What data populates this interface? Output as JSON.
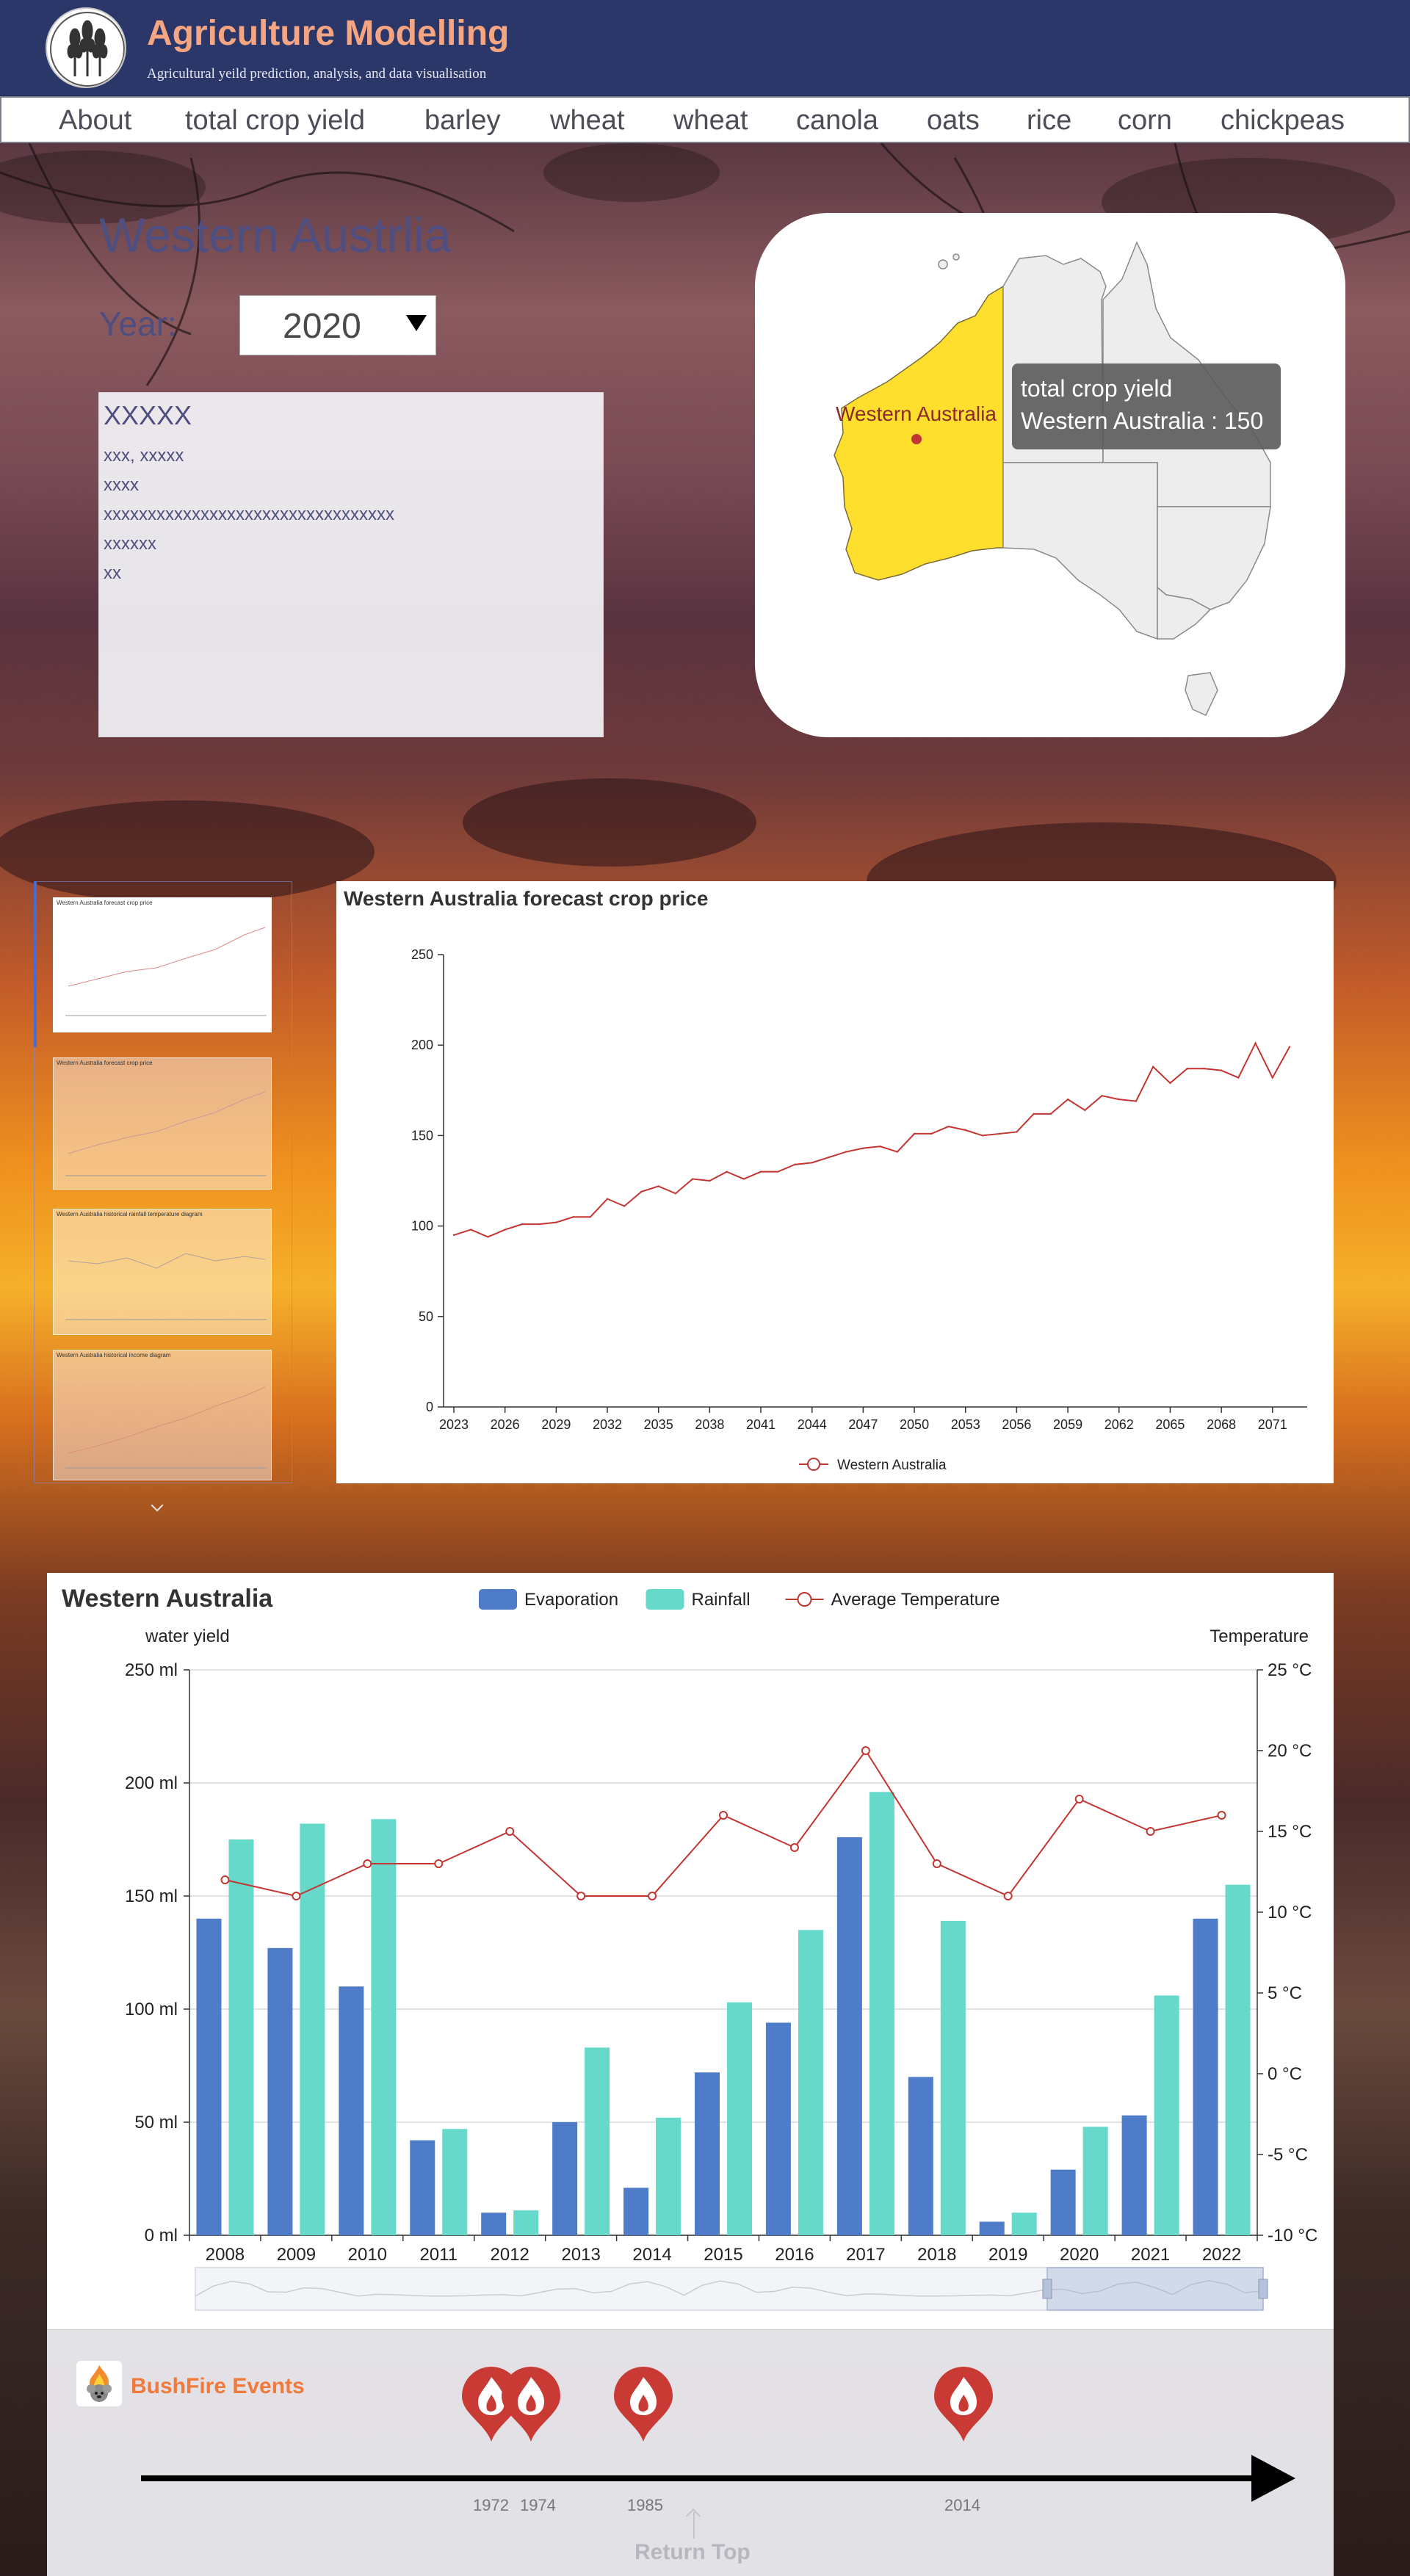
{
  "header": {
    "title": "Agriculture Modelling",
    "subtitle": "Agricultural yeild prediction, analysis, and data visualisation"
  },
  "nav": {
    "items": [
      "About",
      "total crop yield",
      "barley",
      "wheat",
      "wheat",
      "canola",
      "oats",
      "rice",
      "corn",
      "chickpeas"
    ]
  },
  "region": {
    "title": "Western Austrlia",
    "year_label": "Year:",
    "year_value": "2020"
  },
  "info": {
    "lines": [
      "XXXXX",
      "xxx, xxxxx",
      "xxxx",
      "xxxxxxxxxxxxxxxxxxxxxxxxxxxxxxxxx",
      "xxxxxx",
      "xx"
    ]
  },
  "map": {
    "region_label": "Western Australia",
    "tooltip_title": "total crop yield",
    "tooltip_value": "Western Australia : 150",
    "highlight_color": "#ffdf2e"
  },
  "thumbnails": {
    "titles": [
      "Western Australia forecast crop price",
      "Western Australia forecast crop price",
      "Western Australia historical rainfall temperature diagram",
      "Western Australia historical income diagram"
    ]
  },
  "chart_data": [
    {
      "type": "line",
      "title": "Western Australia forecast crop price",
      "x": [
        2023,
        2024,
        2025,
        2026,
        2027,
        2028,
        2029,
        2030,
        2031,
        2032,
        2033,
        2034,
        2035,
        2036,
        2037,
        2038,
        2039,
        2040,
        2041,
        2042,
        2043,
        2044,
        2045,
        2046,
        2047,
        2048,
        2049,
        2050,
        2051,
        2052,
        2053,
        2054,
        2055,
        2056,
        2057,
        2058,
        2059,
        2060,
        2061,
        2062,
        2063,
        2064,
        2065,
        2066,
        2067,
        2068,
        2069,
        2070,
        2071,
        2072
      ],
      "x_ticks": [
        "2023",
        "2026",
        "2029",
        "2032",
        "2035",
        "2038",
        "2041",
        "2044",
        "2047",
        "2050",
        "2053",
        "2056",
        "2059",
        "2062",
        "2065",
        "2068",
        "2071"
      ],
      "ylim": [
        0,
        250
      ],
      "y_ticks": [
        0,
        50,
        100,
        150,
        200,
        250
      ],
      "series": [
        {
          "name": "Western Australia",
          "color": "#c23531",
          "values": [
            95,
            98,
            94,
            98,
            101,
            101,
            102,
            105,
            105,
            115,
            111,
            119,
            122,
            118,
            126,
            125,
            130,
            126,
            130,
            130,
            134,
            135,
            138,
            141,
            143,
            144,
            141,
            151,
            151,
            155,
            153,
            150,
            151,
            152,
            162,
            162,
            170,
            164,
            172,
            170,
            169,
            188,
            179,
            187,
            187,
            186,
            182,
            201,
            182,
            199
          ]
        }
      ]
    },
    {
      "type": "bar",
      "title": "Western Australia",
      "ylabel": "water yield",
      "y2label": "Temperature",
      "categories": [
        "2008",
        "2009",
        "2010",
        "2011",
        "2012",
        "2013",
        "2014",
        "2015",
        "2016",
        "2017",
        "2018",
        "2019",
        "2020",
        "2021",
        "2022"
      ],
      "ylim": [
        0,
        250
      ],
      "y_ticks": [
        "0 ml",
        "50 ml",
        "100 ml",
        "150 ml",
        "200 ml",
        "250 ml"
      ],
      "y2lim": [
        -10,
        25
      ],
      "y2_ticks": [
        "-10 °C",
        "-5 °C",
        "0 °C",
        "5 °C",
        "10 °C",
        "15 °C",
        "20 °C",
        "25 °C"
      ],
      "legend_position": "top-center",
      "series": [
        {
          "name": "Evaporation",
          "type": "bar",
          "color": "#4f7cc8",
          "values": [
            140,
            127,
            110,
            42,
            10,
            50,
            21,
            72,
            94,
            176,
            70,
            6,
            29,
            53,
            140
          ]
        },
        {
          "name": "Rainfall",
          "type": "bar",
          "color": "#67d9cb",
          "values": [
            175,
            182,
            184,
            47,
            11,
            83,
            52,
            103,
            135,
            196,
            139,
            10,
            48,
            106,
            155
          ]
        },
        {
          "name": "Average Temperature",
          "type": "line",
          "axis": "right",
          "color": "#c23531",
          "values": [
            12,
            11,
            13,
            13,
            15,
            11,
            11,
            16,
            14,
            20,
            13,
            11,
            17,
            15,
            16
          ]
        }
      ]
    }
  ],
  "bushfire": {
    "title": "BushFire Events",
    "events": [
      "1972",
      "1974",
      "1985",
      "2014"
    ],
    "return_label": "Return Top"
  }
}
